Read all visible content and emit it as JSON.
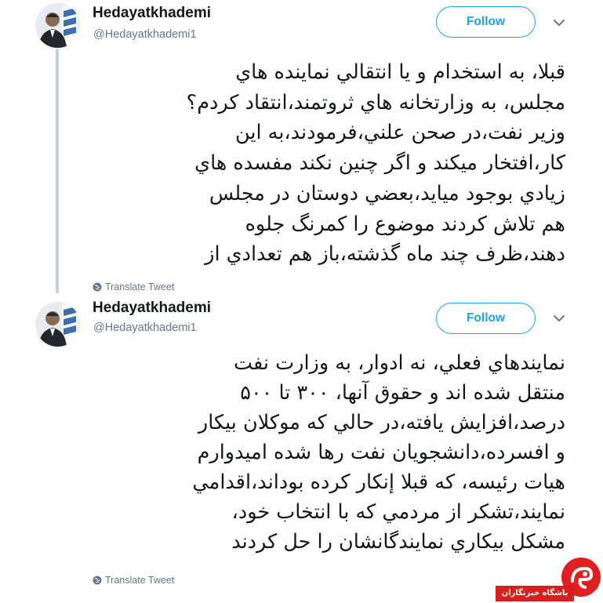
{
  "tweets": [
    {
      "name": "Hedayatkhademi",
      "handle": "@Hedayatkhademi1",
      "follow_label": "Follow",
      "caret_icon": "chevron-down-icon",
      "lines": [
        "قبلا، به استخدام و يا انتقالي نماينده هاي",
        "مجلس، به وزارتخانه هاي ثروتمند،انتقاد كردم؟",
        "وزير نفت،در صحن علني،فرمودند،به اين",
        "كار،افتخار ميكند و اگر چنين نكند مفسده هاي",
        "زيادي بوجود ميايد،بعضي دوستان در مجلس",
        "هم تلاش كردند موضوع را كمرنگ جلوه",
        "دهند،ظرف چند ماه گذشته،باز هم تعدادي از"
      ],
      "translate_label": "Translate Tweet",
      "translate_icon": "globe-icon"
    },
    {
      "name": "Hedayatkhademi",
      "handle": "@Hedayatkhademi1",
      "follow_label": "Follow",
      "caret_icon": "chevron-down-icon",
      "lines": [
        "نمايندهاي فعلي، نه ادوار، به وزارت نفت",
        "منتقل شده اند و حقوق آنها، ۳۰۰ تا ۵۰۰",
        "درصد،افزايش يافته،در حالي كه موكلان بيكار",
        "و افسرده،دانشجويان نفت رها شده اميدوارم",
        "هيات رئيسه، كه قبلا إنكار كرده بوداند،اقدامي",
        "نمايند،تشكر از مردمي كه با انتخاب خود،",
        "مشكل بيكاري نمايندگانشان را حل كردند"
      ],
      "translate_label": "Translate Tweet",
      "translate_icon": "globe-icon"
    }
  ],
  "watermark": {
    "text": "باشگاه خبرنگاران",
    "logo_icon": "news-agency-logo",
    "color": "#d81e1e"
  },
  "colors": {
    "accent": "#1da1f2",
    "text": "#14171a",
    "secondary": "#657786",
    "thread_line": "#c4d0da"
  }
}
